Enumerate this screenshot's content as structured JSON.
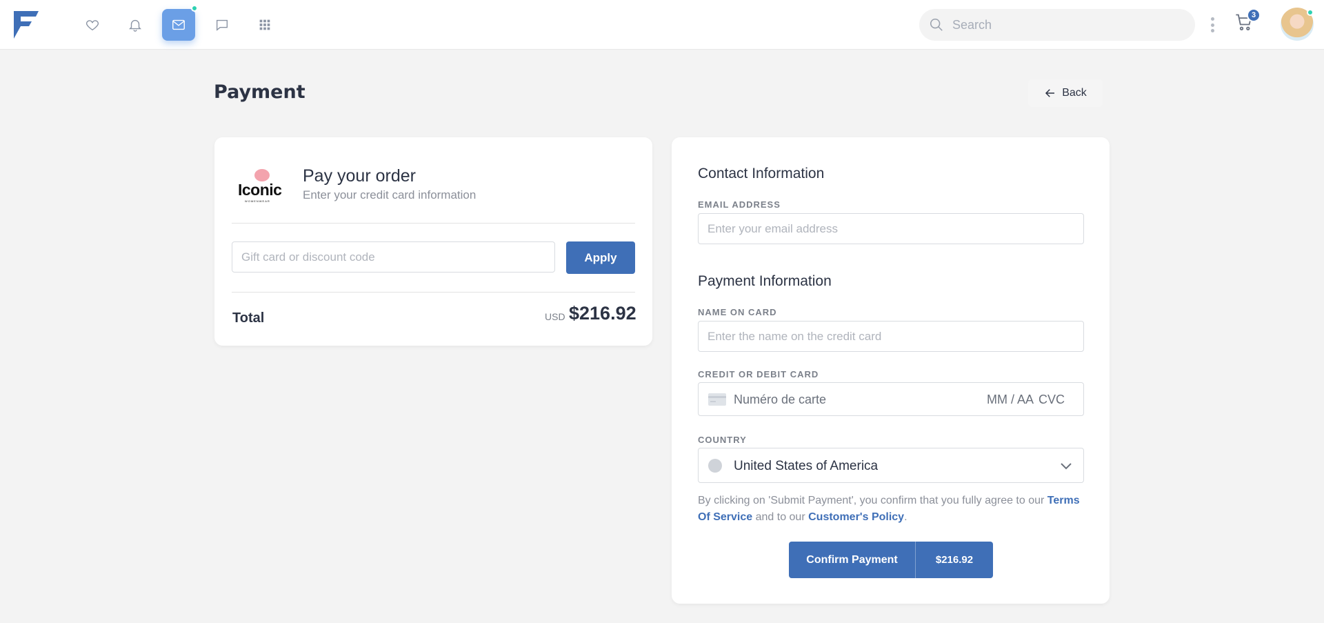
{
  "navbar": {
    "search_placeholder": "Search",
    "cart_count": "3",
    "icons": [
      "heart-icon",
      "bell-icon",
      "mail-icon",
      "chat-icon",
      "apps-grid-icon"
    ]
  },
  "page": {
    "title": "Payment",
    "back_label": "Back"
  },
  "order_card": {
    "brand_name": "Iconic",
    "brand_tagline": "WOMENWEAR",
    "title": "Pay your order",
    "subtitle": "Enter your credit card information",
    "discount_placeholder": "Gift card or discount code",
    "apply_label": "Apply",
    "total_label": "Total",
    "total_currency": "USD",
    "total_amount": "$216.92"
  },
  "payment_form": {
    "contact_title": "Contact Information",
    "email_label": "EMAIL ADDRESS",
    "email_placeholder": "Enter your email address",
    "payment_title": "Payment Information",
    "name_label": "NAME ON CARD",
    "name_placeholder": "Enter the name on the credit card",
    "card_label": "CREDIT OR DEBIT CARD",
    "card_number_placeholder": "Numéro de carte",
    "card_expiry_placeholder": "MM / AA",
    "card_cvc_placeholder": "CVC",
    "country_label": "COUNTRY",
    "country_value": "United States of America",
    "terms_text_1": "By clicking on 'Submit Payment', you confirm that you fully agree to our ",
    "terms_link": "Terms Of Service",
    "terms_text_2": " and to our ",
    "policy_link": "Customer's Policy",
    "terms_text_3": ".",
    "confirm_label": "Confirm Payment",
    "confirm_amount": "$216.92"
  },
  "colors": {
    "accent": "#3f6fb7",
    "active_nav": "#6b9fe6",
    "status_dot": "#2ed1b2"
  }
}
